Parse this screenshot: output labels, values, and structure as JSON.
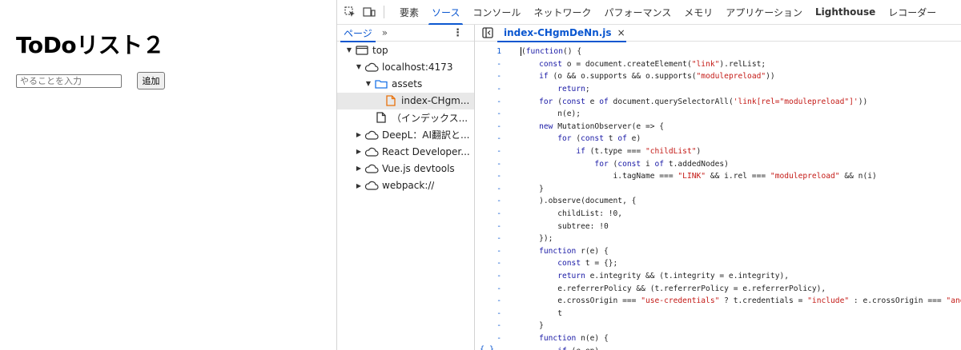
{
  "app": {
    "title": "ToDoリスト２",
    "input_placeholder": "やることを入力",
    "add_button": "追加"
  },
  "devtools": {
    "tabs": [
      "要素",
      "ソース",
      "コンソール",
      "ネットワーク",
      "パフォーマンス",
      "メモリ",
      "アプリケーション",
      "Lighthouse",
      "レコーダー"
    ],
    "active_tab": "ソース",
    "navigator": {
      "tab_label": "ページ",
      "more_label": "»",
      "tree": [
        {
          "label": "top",
          "depth": 0,
          "arrow": "▼",
          "icon": "frame-icon"
        },
        {
          "label": "localhost:4173",
          "depth": 1,
          "arrow": "▼",
          "icon": "cloud-icon"
        },
        {
          "label": "assets",
          "depth": 2,
          "arrow": "▼",
          "icon": "folder-icon"
        },
        {
          "label": "index-CHgm...",
          "depth": 3,
          "arrow": "",
          "icon": "file-js-icon",
          "selected": true
        },
        {
          "label": "（インデックス...",
          "depth": 2,
          "arrow": "",
          "icon": "file-icon"
        },
        {
          "label": "DeepL：AI翻訳と...",
          "depth": 1,
          "arrow": "▶",
          "icon": "cloud-icon"
        },
        {
          "label": "React Developer...",
          "depth": 1,
          "arrow": "▶",
          "icon": "cloud-icon"
        },
        {
          "label": "Vue.js devtools",
          "depth": 1,
          "arrow": "▶",
          "icon": "cloud-icon"
        },
        {
          "label": "webpack://",
          "depth": 1,
          "arrow": "▶",
          "icon": "cloud-icon"
        }
      ]
    },
    "editor": {
      "file_tab": "index-CHgmDeNn.js",
      "close_label": "×",
      "bottom_brace": "{ }",
      "lines": [
        {
          "num": "1",
          "text": "(function() {"
        },
        {
          "num": "-",
          "text": "    const o = document.createElement(\"link\").relList;"
        },
        {
          "num": "-",
          "text": "    if (o && o.supports && o.supports(\"modulepreload\"))"
        },
        {
          "num": "-",
          "text": "        return;"
        },
        {
          "num": "-",
          "text": "    for (const e of document.querySelectorAll('link[rel=\"modulepreload\"]'))"
        },
        {
          "num": "-",
          "text": "        n(e);"
        },
        {
          "num": "-",
          "text": "    new MutationObserver(e => {"
        },
        {
          "num": "-",
          "text": "        for (const t of e)"
        },
        {
          "num": "-",
          "text": "            if (t.type === \"childList\")"
        },
        {
          "num": "-",
          "text": "                for (const i of t.addedNodes)"
        },
        {
          "num": "-",
          "text": "                    i.tagName === \"LINK\" && i.rel === \"modulepreload\" && n(i)"
        },
        {
          "num": "-",
          "text": "    }"
        },
        {
          "num": "-",
          "text": "    ).observe(document, {"
        },
        {
          "num": "-",
          "text": "        childList: !0,"
        },
        {
          "num": "-",
          "text": "        subtree: !0"
        },
        {
          "num": "-",
          "text": "    });"
        },
        {
          "num": "-",
          "text": "    function r(e) {"
        },
        {
          "num": "-",
          "text": "        const t = {};"
        },
        {
          "num": "-",
          "text": "        return e.integrity && (t.integrity = e.integrity),"
        },
        {
          "num": "-",
          "text": "        e.referrerPolicy && (t.referrerPolicy = e.referrerPolicy),"
        },
        {
          "num": "-",
          "text": "        e.crossOrigin === \"use-credentials\" ? t.credentials = \"include\" : e.crossOrigin === \"anonymous\" ?"
        },
        {
          "num": "-",
          "text": "        t"
        },
        {
          "num": "-",
          "text": "    }"
        },
        {
          "num": "-",
          "text": "    function n(e) {"
        },
        {
          "num": "-",
          "text": "        if (e.ep)"
        }
      ]
    }
  }
}
